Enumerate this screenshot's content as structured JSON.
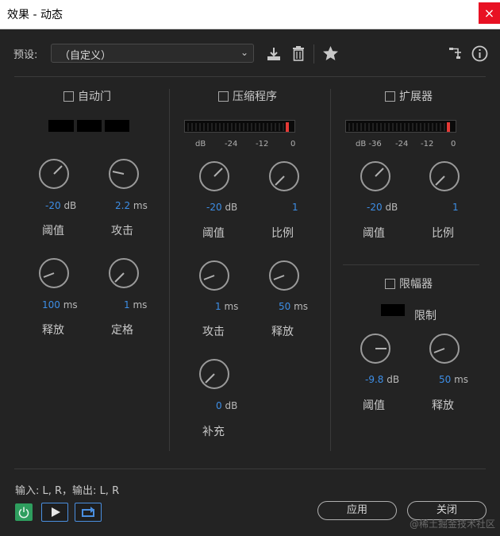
{
  "window": {
    "title": "效果 - 动态",
    "close_label": "×"
  },
  "preset": {
    "label": "预设:",
    "value": "（自定义）"
  },
  "toolbar": {
    "icons": [
      "save-preset-icon",
      "delete-icon",
      "favorite-star-icon",
      "routing-icon",
      "info-icon"
    ]
  },
  "autogate": {
    "title": "自动门",
    "threshold": {
      "value": "-20",
      "unit": "dB",
      "label": "阈值"
    },
    "attack": {
      "value": "2.2",
      "unit": "ms",
      "label": "攻击"
    },
    "release": {
      "value": "100",
      "unit": "ms",
      "label": "释放"
    },
    "hold": {
      "value": "1",
      "unit": "ms",
      "label": "定格"
    }
  },
  "compressor": {
    "title": "压缩程序",
    "scale": [
      "dB",
      "-24",
      "-12",
      "0"
    ],
    "threshold": {
      "value": "-20",
      "unit": "dB",
      "label": "阈值"
    },
    "ratio": {
      "value": "1",
      "label": "比例"
    },
    "attack": {
      "value": "1",
      "unit": "ms",
      "label": "攻击"
    },
    "release": {
      "value": "50",
      "unit": "ms",
      "label": "释放"
    },
    "makeup": {
      "value": "0",
      "unit": "dB",
      "label": "补充"
    }
  },
  "expander": {
    "title": "扩展器",
    "scale": [
      "dB -36",
      "-24",
      "-12",
      "0"
    ],
    "threshold": {
      "value": "-20",
      "unit": "dB",
      "label": "阈值"
    },
    "ratio": {
      "value": "1",
      "label": "比例"
    }
  },
  "limiter": {
    "title": "限幅器",
    "limit_label": "限制",
    "threshold": {
      "value": "-9.8",
      "unit": "dB",
      "label": "阈值"
    },
    "release": {
      "value": "50",
      "unit": "ms",
      "label": "释放"
    }
  },
  "io": {
    "text": "输入: L, R，输出: L, R"
  },
  "buttons": {
    "apply": "应用",
    "close": "关闭"
  },
  "watermark": "@稀土掘金技术社区",
  "colors": {
    "accent_blue": "#3d8ee6",
    "meter_peak": "#e53935",
    "power_green": "#2e9e5e",
    "close_red": "#e81123"
  }
}
